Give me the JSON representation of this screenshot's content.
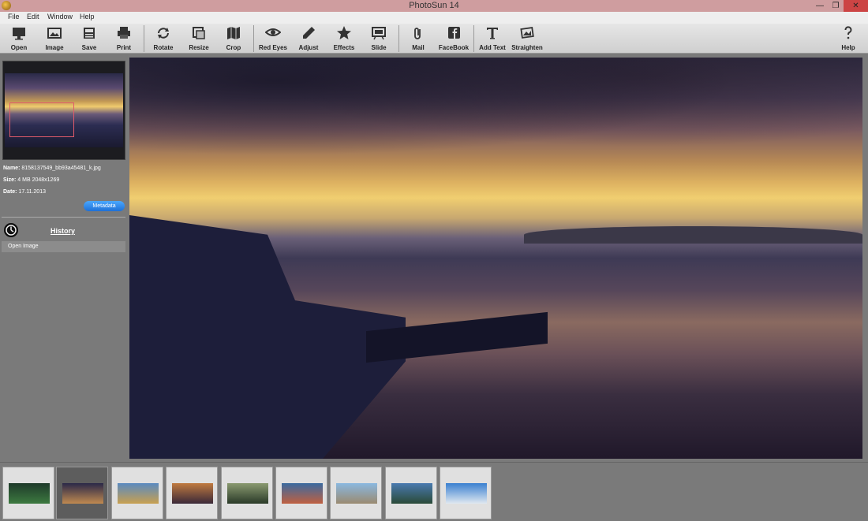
{
  "window": {
    "title": "PhotoSun 14",
    "min": "—",
    "max": "❐",
    "close": "✕"
  },
  "menu": [
    "File",
    "Edit",
    "Window",
    "Help"
  ],
  "toolbar": {
    "open": "Open",
    "image": "Image",
    "save": "Save",
    "print": "Print",
    "rotate": "Rotate",
    "resize": "Resize",
    "crop": "Crop",
    "redeyes": "Red Eyes",
    "adjust": "Adjust",
    "effects": "Effects",
    "slide": "Slide",
    "mail": "Mail",
    "facebook": "FaceBook",
    "addtext": "Add Text",
    "straighten": "Straighten",
    "help": "Help"
  },
  "info": {
    "name_label": "Name:",
    "name_value": "8158137549_bb93a45481_k.jpg",
    "size_label": "Size:",
    "size_value": "4 MB  2048x1269",
    "date_label": "Date:",
    "date_value": "17.11.2013",
    "metadata_button": "Metadata"
  },
  "history": {
    "title": "History",
    "items": [
      "Open Image"
    ]
  },
  "filmstrip": {
    "selected_index": 1,
    "thumbs": [
      {
        "colors": [
          "#1e3a2a",
          "#3d7a40"
        ]
      },
      {
        "colors": [
          "#2a2848",
          "#c08a50"
        ]
      },
      {
        "colors": [
          "#5a8ac0",
          "#c8a050"
        ]
      },
      {
        "colors": [
          "#c07a40",
          "#3a2838"
        ]
      },
      {
        "colors": [
          "#8a9a70",
          "#2a3a28"
        ]
      },
      {
        "colors": [
          "#3a6aa0",
          "#c06040"
        ]
      },
      {
        "colors": [
          "#8ab8e0",
          "#9a8a70"
        ]
      },
      {
        "colors": [
          "#4a7ab0",
          "#2a4a38"
        ]
      },
      {
        "colors": [
          "#3a80d0",
          "#e0e8f0"
        ]
      }
    ]
  }
}
